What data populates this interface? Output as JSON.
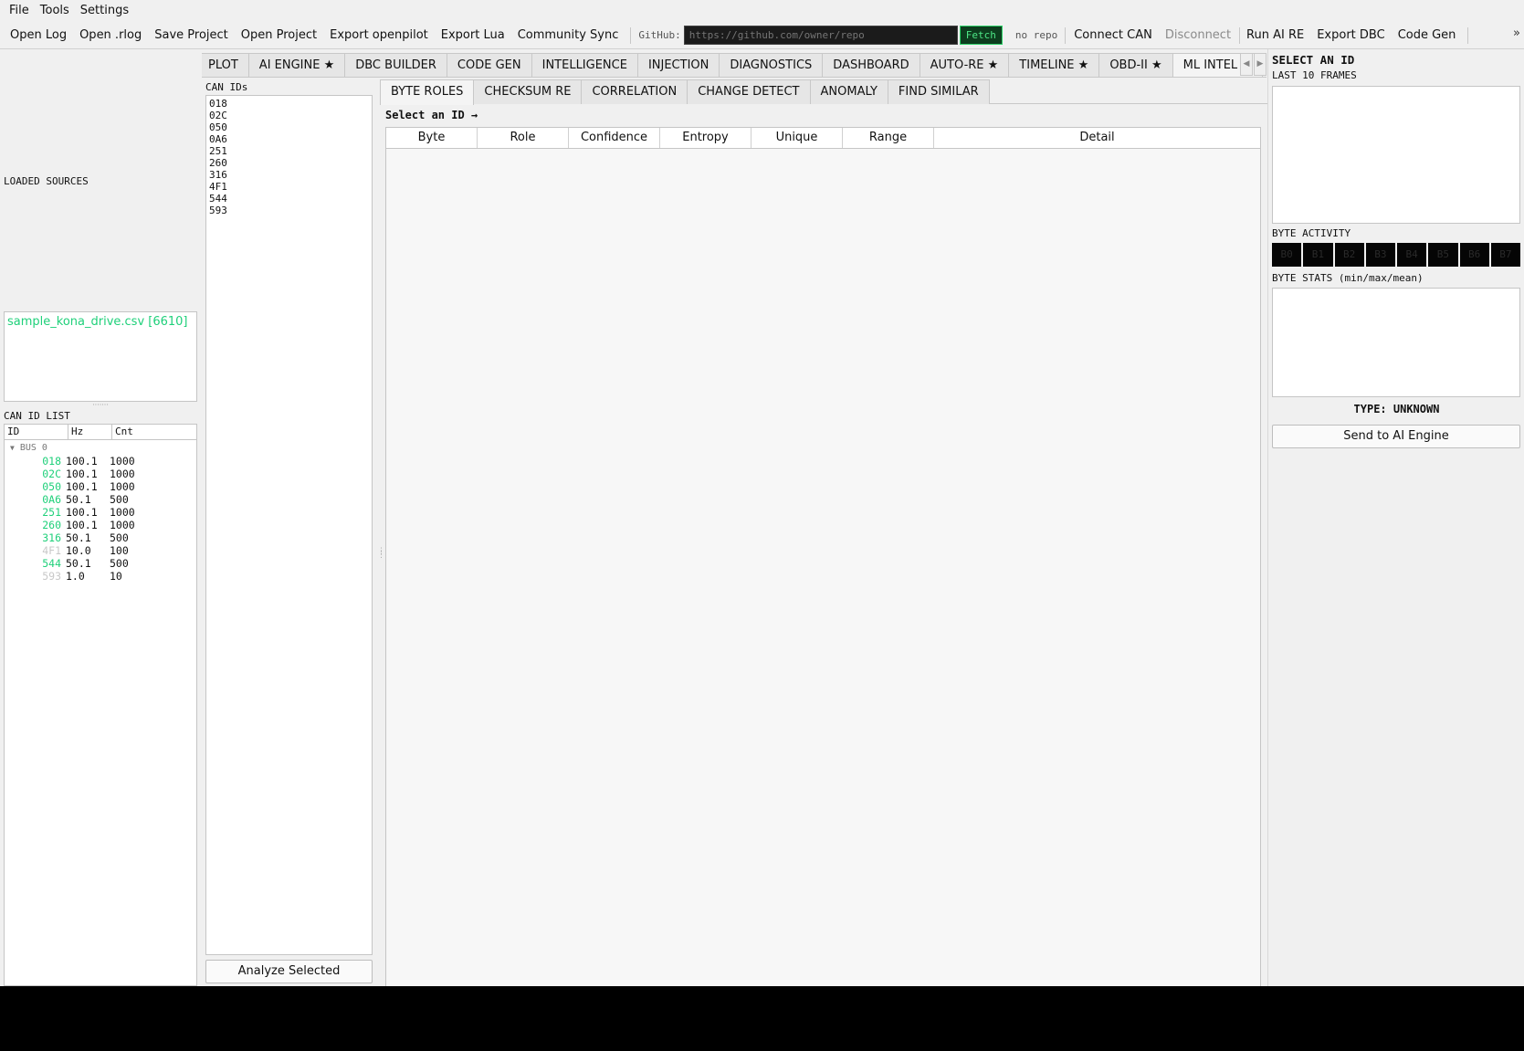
{
  "menu": [
    "File",
    "Tools",
    "Settings"
  ],
  "toolbar": {
    "buttons": [
      "Open Log",
      "Open .rlog",
      "Save Project",
      "Open Project",
      "Export openpilot",
      "Export Lua",
      "Community Sync"
    ],
    "github_label": "GitHub:",
    "github_placeholder": "https://github.com/owner/repo",
    "fetch_label": "Fetch",
    "repo_status": "no repo",
    "connect_label": "Connect CAN",
    "disconnect_label": "Disconnect",
    "run_ai_label": "Run AI RE",
    "export_dbc_label": "Export DBC",
    "code_gen_label": "Code Gen",
    "overflow": "»"
  },
  "left": {
    "loaded_sources_label": "LOADED SOURCES",
    "sources": [
      "sample_kona_drive.csv  [6610]"
    ],
    "can_id_list_label": "CAN ID LIST",
    "columns": [
      "ID",
      "Hz",
      "Cnt"
    ],
    "bus_label": "BUS 0",
    "rows": [
      {
        "id": "018",
        "hz": "100.1",
        "cnt": "1000"
      },
      {
        "id": "02C",
        "hz": "100.1",
        "cnt": "1000"
      },
      {
        "id": "050",
        "hz": "100.1",
        "cnt": "1000"
      },
      {
        "id": "0A6",
        "hz": "50.1",
        "cnt": "500"
      },
      {
        "id": "251",
        "hz": "100.1",
        "cnt": "1000"
      },
      {
        "id": "260",
        "hz": "100.1",
        "cnt": "1000"
      },
      {
        "id": "316",
        "hz": "50.1",
        "cnt": "500"
      },
      {
        "id": "4F1",
        "hz": "10.0",
        "cnt": "100"
      },
      {
        "id": "544",
        "hz": "50.1",
        "cnt": "500"
      },
      {
        "id": "593",
        "hz": "1.0",
        "cnt": "10"
      }
    ]
  },
  "main_tabs": [
    "PLOT",
    "AI ENGINE ★",
    "DBC BUILDER",
    "CODE GEN",
    "INTELLIGENCE",
    "INJECTION",
    "DIAGNOSTICS",
    "DASHBOARD",
    "AUTO-RE ★",
    "TIMELINE ★",
    "OBD-II ★",
    "ML INTEL ★"
  ],
  "active_main_tab": "ML INTEL ★",
  "ml": {
    "can_ids_label": "CAN IDs",
    "can_ids": [
      "018",
      "02C",
      "050",
      "0A6",
      "251",
      "260",
      "316",
      "4F1",
      "544",
      "593"
    ],
    "analyze_label": "Analyze Selected",
    "sub_tabs": [
      "BYTE ROLES",
      "CHECKSUM RE",
      "CORRELATION",
      "CHANGE DETECT",
      "ANOMALY",
      "FIND SIMILAR"
    ],
    "active_sub_tab": "BYTE ROLES",
    "select_hint": "Select an ID →",
    "table_columns": [
      "Byte",
      "Role",
      "Confidence",
      "Entropy",
      "Unique",
      "Range",
      "Detail"
    ]
  },
  "right": {
    "title": "SELECT AN ID",
    "last_frames_label": "LAST 10 FRAMES",
    "byte_activity_label": "BYTE ACTIVITY",
    "bytes": [
      "B0",
      "B1",
      "B2",
      "B3",
      "B4",
      "B5",
      "B6",
      "B7"
    ],
    "byte_stats_label": "BYTE STATS (min/max/mean)",
    "type_label": "TYPE: UNKNOWN",
    "send_label": "Send to AI Engine"
  },
  "colors": {
    "accent_green": "#1fd07a",
    "dim_id": "#c8c8c8",
    "fetch_bg": "#0d3d1e"
  }
}
